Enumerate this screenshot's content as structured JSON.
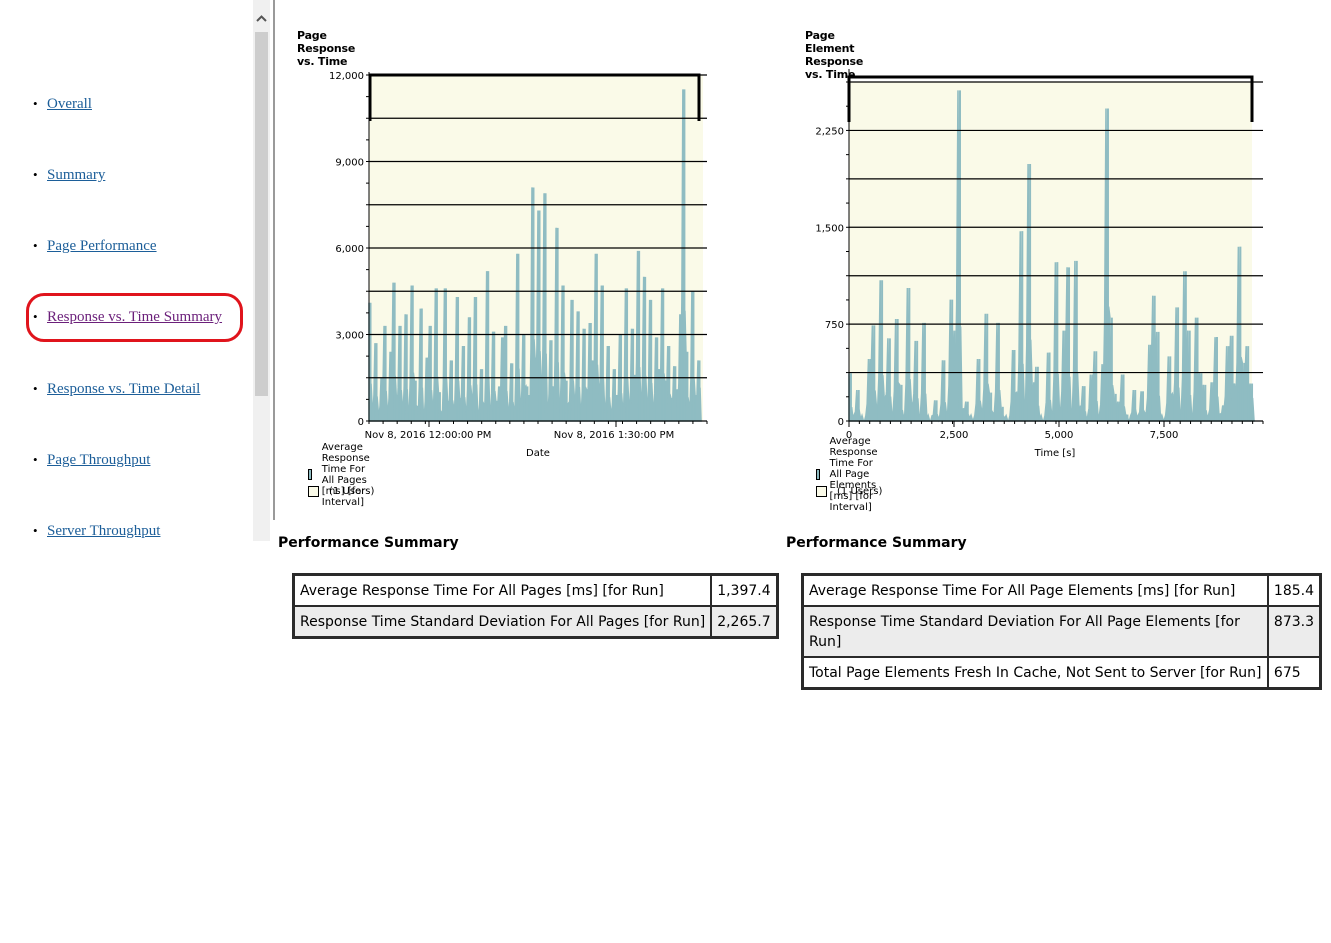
{
  "nav": {
    "items": [
      {
        "label": "Overall",
        "visited": false
      },
      {
        "label": "Summary",
        "visited": false
      },
      {
        "label": "Page Performance",
        "visited": false
      },
      {
        "label": "Response vs. Time Summary",
        "visited": true,
        "highlighted": true
      },
      {
        "label": "Response vs. Time Detail",
        "visited": false
      },
      {
        "label": "Page Throughput",
        "visited": false
      },
      {
        "label": "Server Throughput",
        "visited": false
      }
    ],
    "highlight_color": "#e0141c",
    "link_color": "#1c5e99",
    "visited_color": "#6b1f7a",
    "scroll_up_icon": "chevron-up-icon"
  },
  "colors": {
    "series_fill": "#8fbcc2",
    "plot_background": "#fafae8",
    "users_swatch": "#fafae8"
  },
  "chart_data": [
    {
      "type": "area",
      "title": "Page Response vs. Time",
      "xlabel": "Date",
      "ylabel": "",
      "ylim": [
        0,
        12000
      ],
      "y_ticks": [
        "0",
        "3,000",
        "6,000",
        "9,000",
        "12,000"
      ],
      "y_gridlines": [
        1500,
        3000,
        4500,
        6000,
        7500,
        9000,
        10500,
        12000
      ],
      "x_tick_labels": [
        "Nov 8, 2016 12:00:00 PM",
        "Nov 8, 2016 1:30:00 PM"
      ],
      "grid": true,
      "legend_position": "bottom-left",
      "legend": [
        {
          "label": "Average Response Time For All Pages [ms] [for Interval]",
          "swatch": "series"
        },
        {
          "label": "(1 Users)",
          "swatch": "users"
        }
      ],
      "users_level_note": "1 user active for the whole run",
      "series": [
        {
          "name": "Average Response Time For All Pages [ms] [for Interval]",
          "x_fraction_end": 0.98,
          "values": [
            4100,
            600,
            2700,
            400,
            1500,
            3300,
            500,
            2400,
            4800,
            900,
            3300,
            600,
            3700,
            300,
            4700,
            1400,
            500,
            3900,
            300,
            2200,
            3300,
            600,
            4600,
            1000,
            300,
            4600,
            700,
            2100,
            500,
            4300,
            800,
            2600,
            400,
            3600,
            900,
            4300,
            300,
            1800,
            600,
            5200,
            400,
            3100,
            700,
            1200,
            2900,
            3300,
            500,
            2000,
            400,
            5800,
            800,
            3000,
            1200,
            900,
            8100,
            2200,
            7300,
            1500,
            7900,
            600,
            2800,
            1200,
            6700,
            700,
            4700,
            1400,
            600,
            4200,
            900,
            3800,
            500,
            3200,
            1100,
            3400,
            2100,
            5800,
            1300,
            4700,
            600,
            2600,
            400,
            1800,
            900,
            3000,
            500,
            4600,
            700,
            3200,
            1600,
            5900,
            900,
            5000,
            700,
            4200,
            600,
            2900,
            1800,
            4600,
            1400,
            2600,
            800,
            1900,
            1100,
            3700,
            11500,
            2400,
            600,
            4500,
            900,
            2100
          ]
        }
      ]
    },
    {
      "type": "area",
      "title": "Page Element Response vs. Time",
      "xlabel": "Time [s]",
      "ylabel": "",
      "ylim": [
        0,
        2625
      ],
      "xlim": [
        0,
        9900
      ],
      "y_ticks": [
        "0",
        "750",
        "1,500",
        "2,250"
      ],
      "y_gridlines": [
        375,
        750,
        1125,
        1500,
        1875,
        2250,
        2625
      ],
      "x_ticks": [
        "0",
        "2,500",
        "5,000",
        "7,500"
      ],
      "grid": true,
      "legend_position": "bottom-left",
      "legend": [
        {
          "label": "Average Response Time For All Page Elements [ms] [for Interval]",
          "swatch": "series"
        },
        {
          "label": "(1 Users)",
          "swatch": "users"
        }
      ],
      "series": [
        {
          "name": "Average Response Time For All Page Elements [ms] [for Interval]",
          "x_end": 9650,
          "values": [
            370,
            20,
            240,
            10,
            0,
            480,
            740,
            120,
            1090,
            200,
            640,
            50,
            790,
            280,
            30,
            1030,
            150,
            620,
            20,
            760,
            10,
            0,
            160,
            10,
            470,
            60,
            940,
            700,
            2560,
            100,
            150,
            20,
            10,
            480,
            90,
            830,
            220,
            60,
            760,
            110,
            20,
            0,
            550,
            220,
            1470,
            140,
            1990,
            300,
            420,
            10,
            0,
            530,
            60,
            1230,
            100,
            700,
            1190,
            60,
            1240,
            120,
            270,
            0,
            360,
            540,
            20,
            440,
            2420,
            800,
            210,
            150,
            360,
            50,
            0,
            240,
            20,
            230,
            60,
            590,
            970,
            690,
            20,
            10,
            500,
            210,
            880,
            60,
            1160,
            700,
            30,
            800,
            370,
            280,
            20,
            300,
            650,
            40,
            120,
            580,
            660,
            290,
            1350,
            450,
            580,
            290
          ]
        }
      ]
    }
  ],
  "tables": [
    {
      "heading": "Performance Summary",
      "rows": [
        {
          "label": "Average Response Time For All Pages [ms] [for Run]",
          "value": "1,397.4"
        },
        {
          "label": "Response Time Standard Deviation For All Pages [for Run]",
          "value": "2,265.7"
        }
      ]
    },
    {
      "heading": "Performance Summary",
      "rows": [
        {
          "label": "Average Response Time For All Page Elements [ms] [for Run]",
          "value": "185.4"
        },
        {
          "label": "Response Time Standard Deviation For All Page Elements [for Run]",
          "value": "873.3"
        },
        {
          "label": "Total Page Elements Fresh In Cache, Not Sent to Server [for Run]",
          "value": "675"
        }
      ]
    }
  ]
}
